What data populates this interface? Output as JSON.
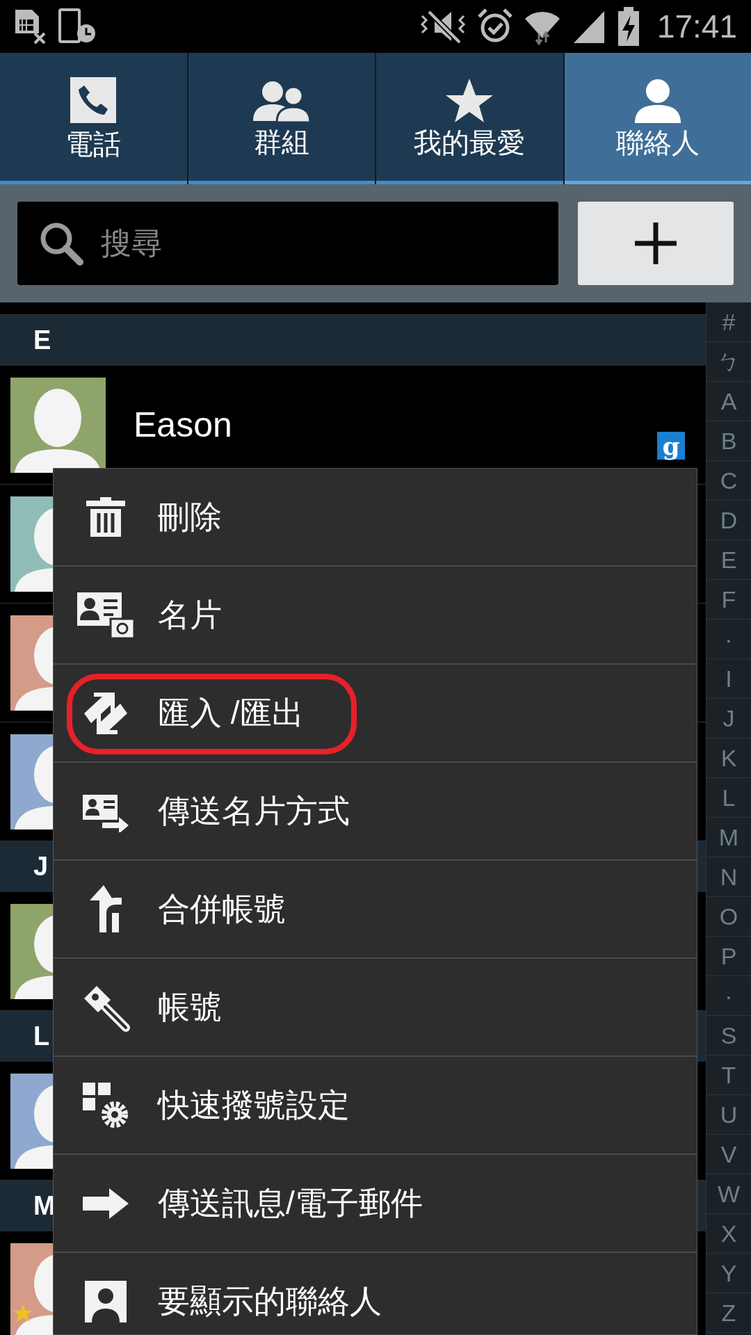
{
  "status_bar": {
    "time": "17:41"
  },
  "tabs": [
    {
      "label": "電話",
      "selected": false
    },
    {
      "label": "群組",
      "selected": false
    },
    {
      "label": "我的最愛",
      "selected": false
    },
    {
      "label": "聯絡人",
      "selected": true
    }
  ],
  "search": {
    "placeholder": "搜尋"
  },
  "sections": [
    {
      "letter": "E",
      "contacts": [
        {
          "name": "Eason",
          "color": "#8fa46a",
          "account": "g",
          "favorite": false
        },
        {
          "color": "#8fbdb5",
          "favorite": false
        },
        {
          "color": "#d49b89",
          "favorite": false
        },
        {
          "color": "#8ea8cf",
          "favorite": false
        }
      ]
    },
    {
      "letter": "J",
      "contacts": [
        {
          "color": "#8fa46a",
          "favorite": false
        }
      ]
    },
    {
      "letter": "L",
      "contacts": [
        {
          "color": "#8ea8cf",
          "favorite": false
        }
      ]
    },
    {
      "letter": "M",
      "contacts": [
        {
          "color": "#d49b89",
          "favorite": true
        }
      ]
    }
  ],
  "index_bar": [
    "#",
    "ㄅ",
    "A",
    "B",
    "C",
    "D",
    "E",
    "F",
    "·",
    "I",
    "J",
    "K",
    "L",
    "M",
    "N",
    "O",
    "P",
    "·",
    "S",
    "T",
    "U",
    "V",
    "W",
    "X",
    "Y",
    "Z"
  ],
  "menu": [
    {
      "label": "刪除",
      "highlighted": false
    },
    {
      "label": "名片",
      "highlighted": false
    },
    {
      "label": "匯入 /匯出",
      "highlighted": true
    },
    {
      "label": "傳送名片方式",
      "highlighted": false
    },
    {
      "label": "合併帳號",
      "highlighted": false
    },
    {
      "label": "帳號",
      "highlighted": false
    },
    {
      "label": "快速撥號設定",
      "highlighted": false
    },
    {
      "label": "傳送訊息/電子郵件",
      "highlighted": false
    },
    {
      "label": "要顯示的聯絡人",
      "highlighted": false
    }
  ]
}
